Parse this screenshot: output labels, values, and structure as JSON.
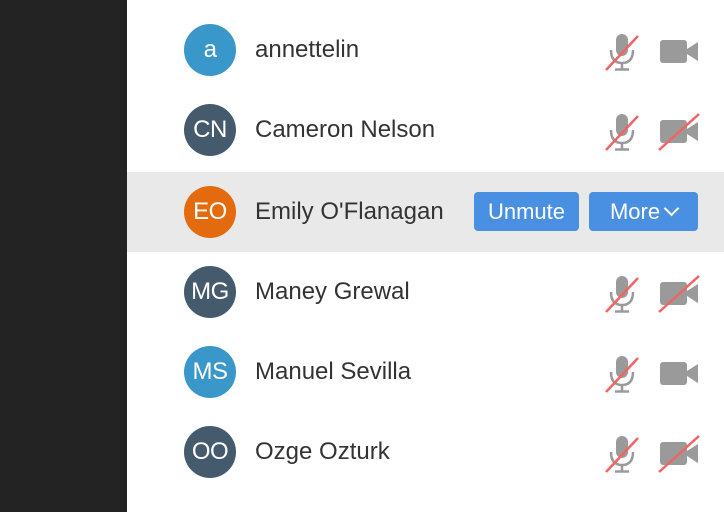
{
  "participants": [
    {
      "initials": "a",
      "name": "annettelin",
      "avatar_color": "#3a97c9",
      "mic": "muted",
      "camera": "on"
    },
    {
      "initials": "CN",
      "name": "Cameron Nelson",
      "avatar_color": "#465a6e",
      "mic": "muted",
      "camera": "off"
    },
    {
      "initials": "EO",
      "name": "Emily O'Flanagan",
      "avatar_color": "#e36b0e",
      "hovered": true,
      "actions": {
        "unmute_label": "Unmute",
        "more_label": "More"
      }
    },
    {
      "initials": "MG",
      "name": "Maney Grewal",
      "avatar_color": "#465a6e",
      "mic": "muted",
      "camera": "off"
    },
    {
      "initials": "MS",
      "name": "Manuel Sevilla",
      "avatar_color": "#3a97c9",
      "mic": "muted",
      "camera": "on"
    },
    {
      "initials": "OO",
      "name": "Ozge Ozturk",
      "avatar_color": "#465a6e",
      "mic": "muted",
      "camera": "off"
    }
  ],
  "colors": {
    "left_panel": "#232323",
    "hover_row": "#e9e9e9",
    "button": "#4a90e2",
    "icon_gray": "#999999",
    "strike_red": "#f06464"
  },
  "icons": {
    "mic_muted": "microphone-muted-icon",
    "camera_on": "video-camera-icon",
    "camera_off": "video-camera-off-icon",
    "more_chevron": "chevron-down-icon"
  }
}
